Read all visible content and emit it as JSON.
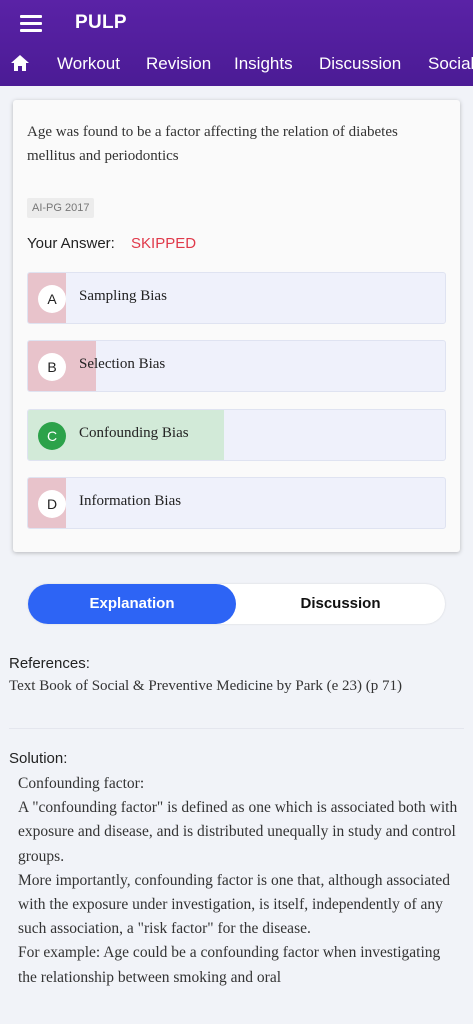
{
  "app": {
    "title": "PULP"
  },
  "icons": {
    "menu": "hamburger-menu-icon",
    "home": "home-icon"
  },
  "nav": {
    "tabs": [
      "Workout",
      "Revision",
      "Insights",
      "Discussion",
      "Social"
    ]
  },
  "question": {
    "text": "Age was found to be a factor affecting the relation of diabetes mellitus and periodontics",
    "tag": "AI-PG 2017",
    "answer_label": "Your Answer:",
    "answer_value": "SKIPPED",
    "options": [
      {
        "letter": "A",
        "text": "Sampling Bias"
      },
      {
        "letter": "B",
        "text": "Selection Bias"
      },
      {
        "letter": "C",
        "text": "Confounding Bias"
      },
      {
        "letter": "D",
        "text": "Information Bias"
      }
    ]
  },
  "colors": {
    "header": "#4f1d9a",
    "skipped": "#e0394a",
    "correct": "#2ca24a",
    "correct_fill": "#d2ead8",
    "wrong_fill": "#e8c3cb",
    "active_segment": "#2d64f5"
  },
  "segments": {
    "explanation": "Explanation",
    "discussion": "Discussion"
  },
  "references": {
    "heading": "References:",
    "text": "Text Book of Social & Preventive Medicine by Park (e 23) (p 71)"
  },
  "solution": {
    "heading": "Solution:",
    "paragraphs": [
      "Confounding factor:",
      "A \"confounding factor\" is defined as one which is associated both with exposure and disease, and is distributed unequally in study and control groups.",
      "More importantly, confounding factor is one that, although associated with the exposure under investigation, is itself, independently of any such association, a \"risk factor\" for the disease.",
      "For example: Age could be a confounding factor when investigating the relationship between smoking and oral"
    ]
  }
}
